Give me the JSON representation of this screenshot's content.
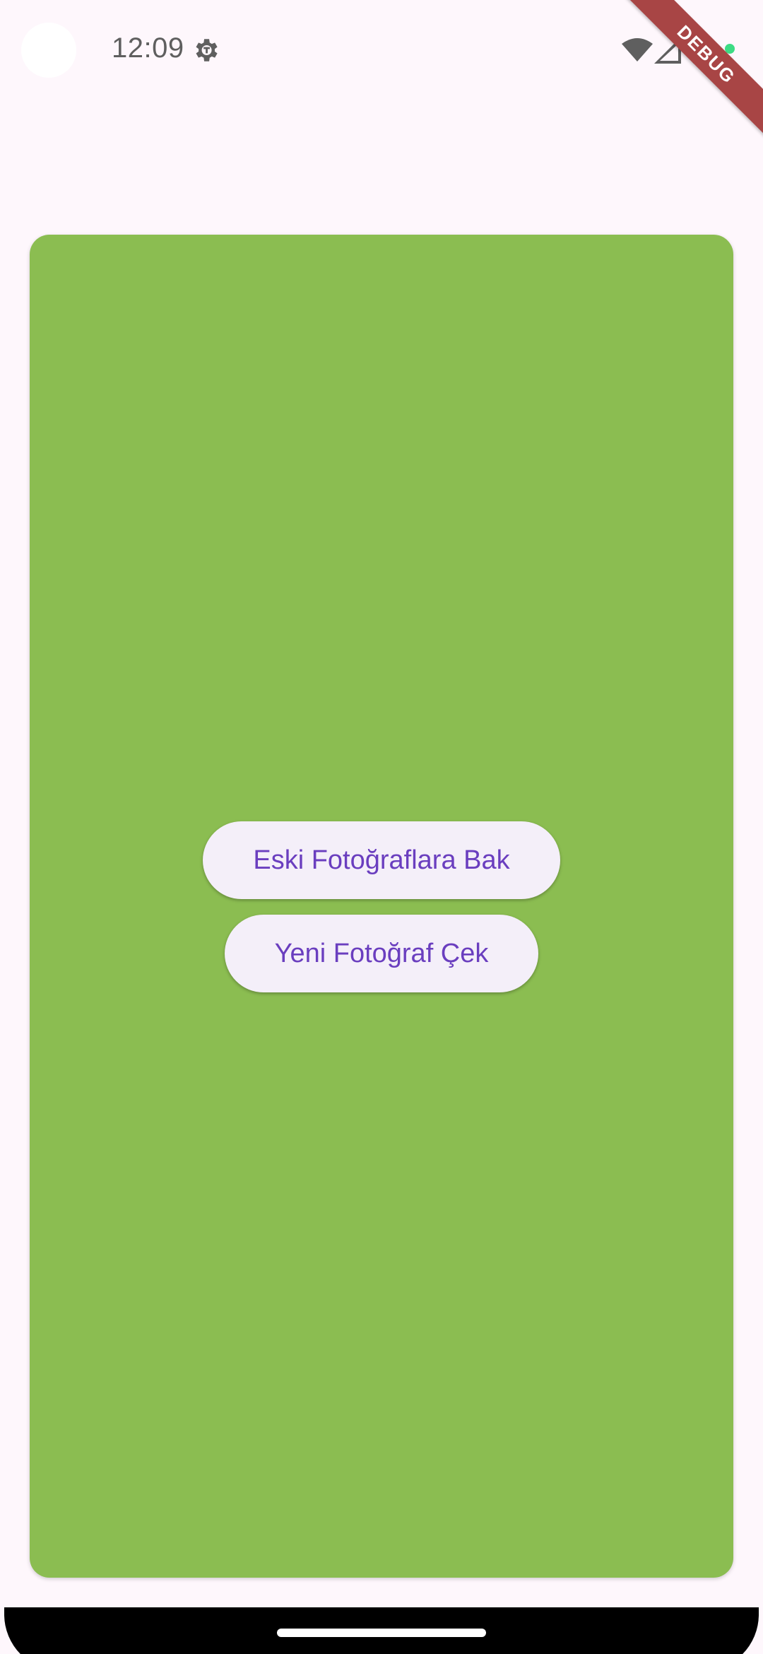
{
  "status_bar": {
    "time": "12:09",
    "icons": [
      "settings-icon",
      "wifi-icon",
      "signal-icon",
      "battery-icon"
    ]
  },
  "debug_banner": {
    "label": "DEBUG"
  },
  "card": {
    "color": "#8BBD51"
  },
  "buttons": {
    "old_photos_label": "Eski Fotoğraflara Bak",
    "new_photo_label": "Yeni Fotoğraf Çek",
    "text_color": "#6A3EBF",
    "background": "#F4EFF9"
  }
}
